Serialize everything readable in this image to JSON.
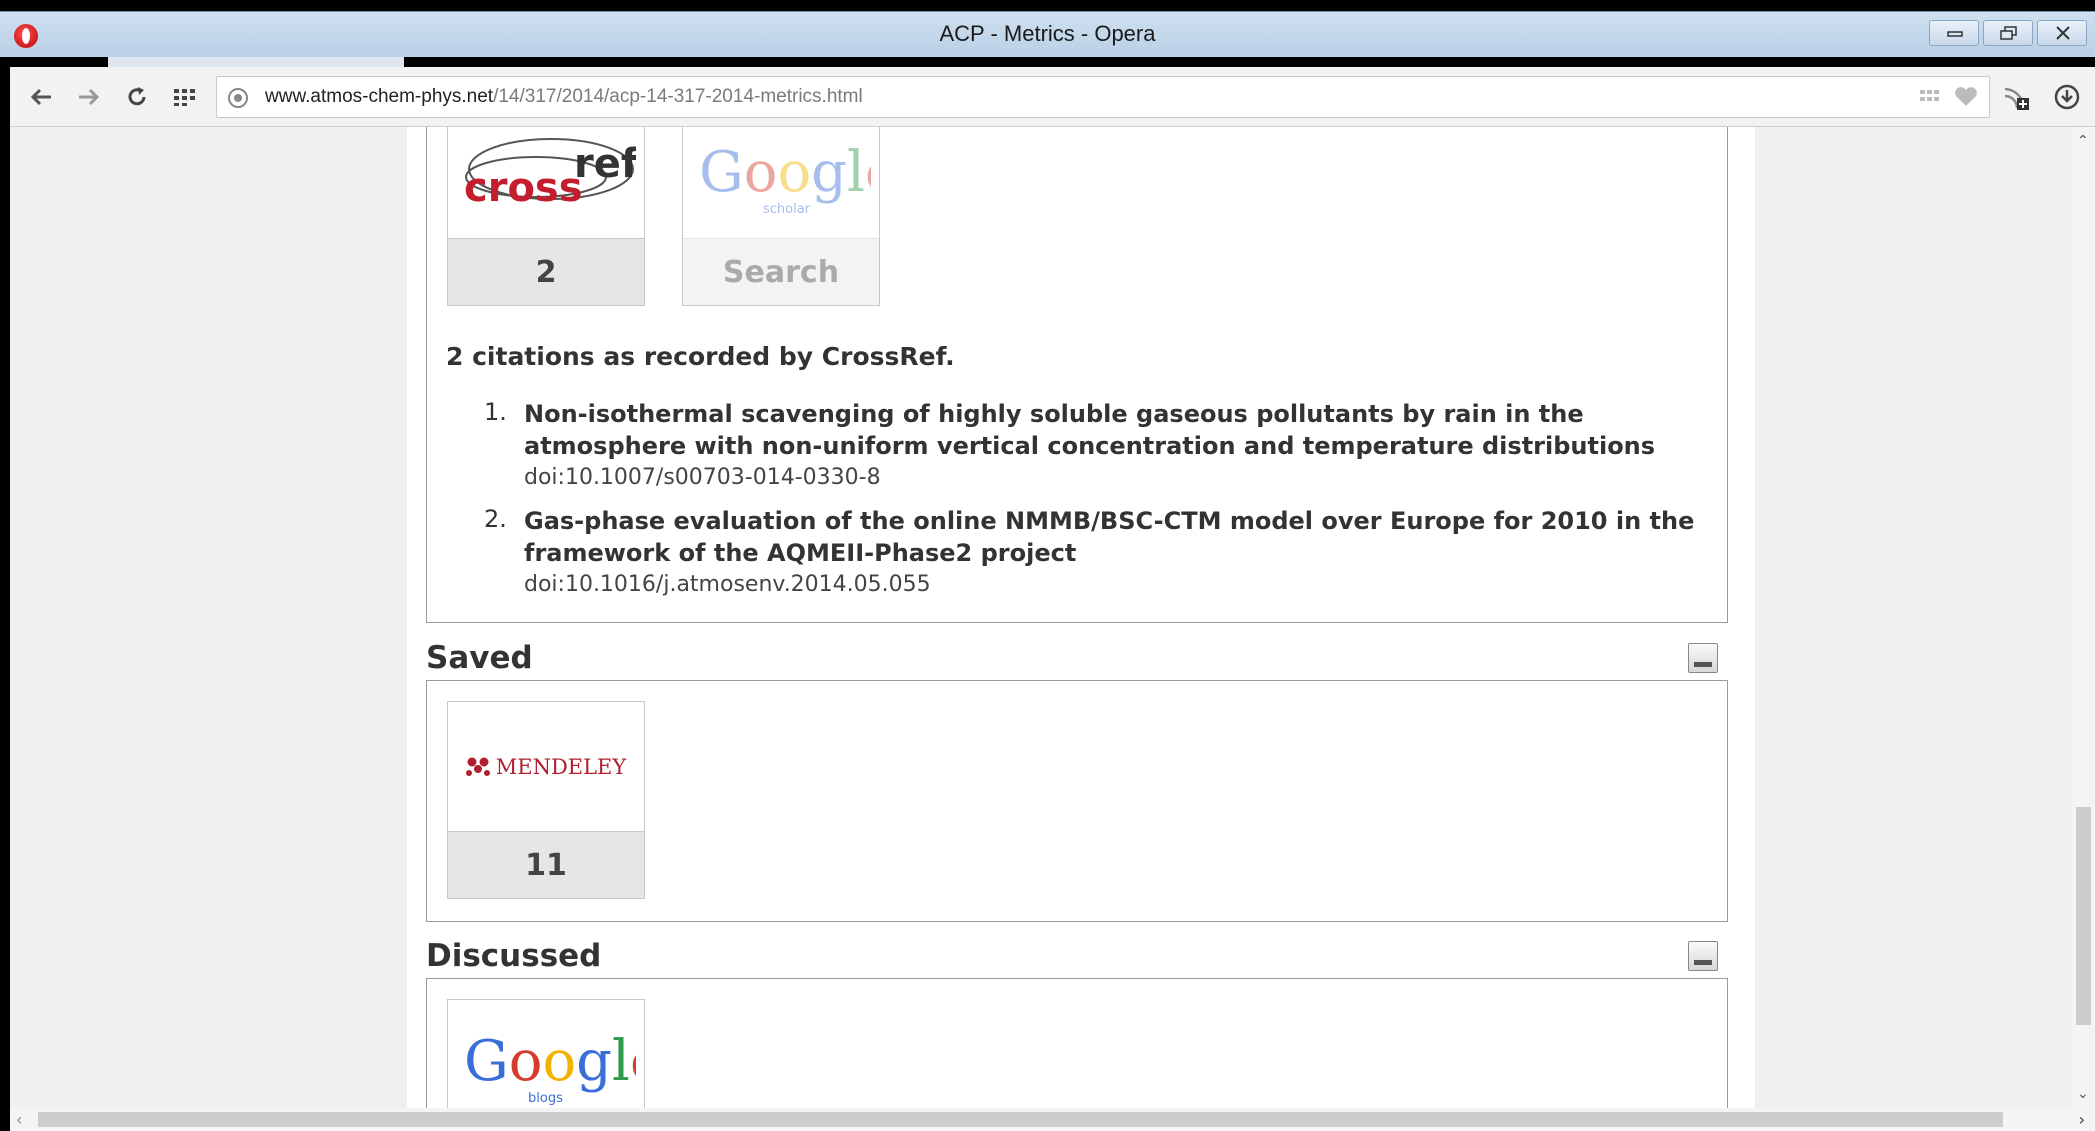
{
  "window": {
    "title": "ACP - Metrics - Opera"
  },
  "toolbar": {
    "url_host": "www.atmos-chem-phys.net",
    "url_path": "/14/317/2014/acp-14-317-2014-metrics.html"
  },
  "cited": {
    "tiles": [
      {
        "logo": "crossref",
        "logo_text": "crossref",
        "count": "2"
      },
      {
        "logo": "google-scholar",
        "logo_text": "Google",
        "logo_subtext": "scholar",
        "count": "Search"
      }
    ],
    "heading": "2 citations as recorded by CrossRef.",
    "citations": [
      {
        "num": "1.",
        "title": "Non-isothermal scavenging of highly soluble gaseous pollutants by rain in the atmosphere with non-uniform vertical concentration and temperature distributions",
        "doi": "doi:10.1007/s00703-014-0330-8"
      },
      {
        "num": "2.",
        "title": "Gas-phase evaluation of the online NMMB/BSC-CTM model over Europe for 2010 in the framework of the AQMEII-Phase2 project",
        "doi": "doi:10.1016/j.atmosenv.2014.05.055"
      }
    ]
  },
  "saved": {
    "heading": "Saved",
    "tile": {
      "logo": "mendeley",
      "logo_text": "MENDELEY",
      "count": "11"
    }
  },
  "discussed": {
    "heading": "Discussed",
    "tile": {
      "logo": "google-blogs",
      "logo_text": "Google",
      "logo_subtext": "blogs"
    }
  }
}
